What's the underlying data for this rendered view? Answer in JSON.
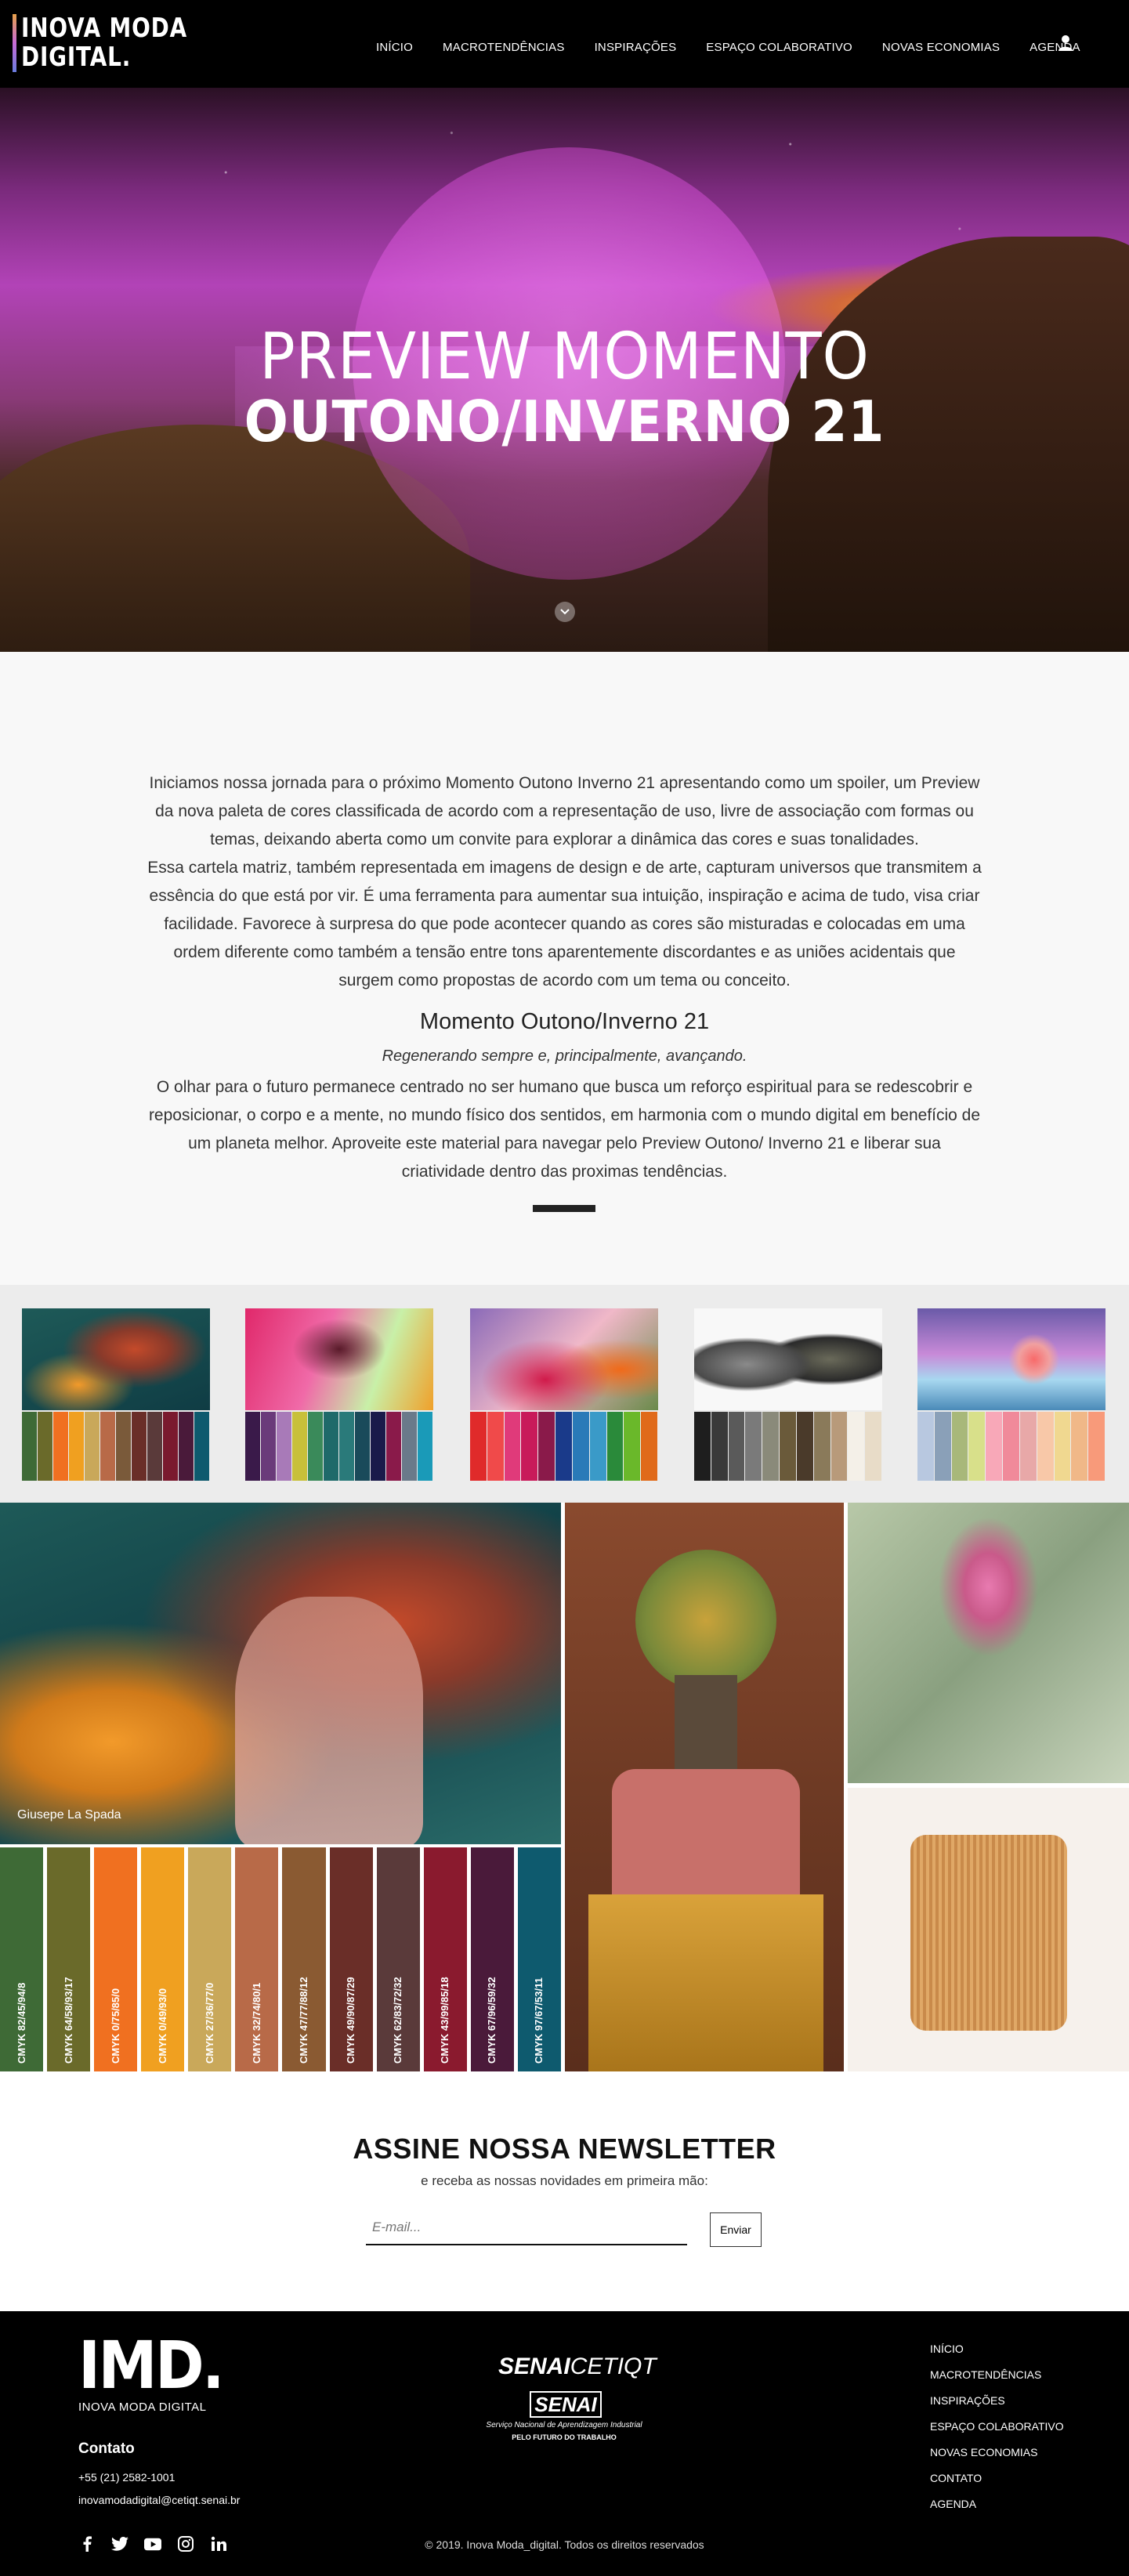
{
  "header": {
    "logo_line1": "INOVA MODA",
    "logo_line2": "DIGITAL.",
    "nav": [
      "INÍCIO",
      "MACROTENDÊNCIAS",
      "INSPIRAÇÕES",
      "ESPAÇO COLABORATIVO",
      "NOVAS ECONOMIAS",
      "AGENDA"
    ],
    "user_icon": "user-icon"
  },
  "hero": {
    "title_line1": "PREVIEW MOMENTO",
    "title_line2": "OUTONO/INVERNO 21",
    "scroll_icon": "chevron-down-icon"
  },
  "intro": {
    "paragraph1": "Iniciamos nossa jornada para o próximo Momento Outono Inverno 21 apresentando como um spoiler, um Preview da nova paleta de cores classificada de acordo com a representação de uso, livre de associação com formas ou temas, deixando aberta como um convite para explorar a dinâmica das cores e suas tonalidades.",
    "paragraph2": "Essa cartela matriz, também representada em imagens de design e de arte, capturam universos que transmitem a essência do que está por vir. É uma ferramenta para aumentar sua intuição, inspiração e acima de tudo, visa criar facilidade. Favorece à surpresa do que pode acontecer quando as cores são misturadas e colocadas em uma ordem diferente como também a tensão entre tons aparentemente discordantes e as uniões acidentais que surgem como propostas de acordo com um tema ou conceito.",
    "subtitle": "Momento Outono/Inverno 21",
    "italic_line": "Regenerando sempre e, principalmente, avançando.",
    "paragraph3": "O olhar para o futuro permanece centrado no ser humano que busca um reforço espiritual para se redescobrir e reposicionar, o corpo e a mente, no mundo físico dos sentidos, em harmonia com o mundo digital em benefício de um planeta melhor. Aproveite este material para navegar pelo Preview Outono/ Inverno 21 e liberar sua criatividade dentro das proximas tendências."
  },
  "palettes": [
    {
      "image": "underwater-woman",
      "colors": [
        "#3e6a36",
        "#6a6a2a",
        "#f07020",
        "#f0a020",
        "#c9a85a",
        "#b86a48",
        "#7a5a3a",
        "#6a2e28",
        "#5a3a3a",
        "#7a1a2e",
        "#4a1a3a",
        "#0e5a6e"
      ]
    },
    {
      "image": "pink-hair-woman",
      "colors": [
        "#3a1a4a",
        "#6a3a7a",
        "#a87ab8",
        "#c8c03a",
        "#3a8a5a",
        "#1e6a6a",
        "#2a7a7a",
        "#1a4a5a",
        "#1a1a4a",
        "#8a1a4a",
        "#6a7a8a",
        "#1a9ab8"
      ]
    },
    {
      "image": "flowers-fabric",
      "colors": [
        "#e02a2a",
        "#f04a4a",
        "#e03a7a",
        "#c81a5a",
        "#8a1a4a",
        "#1a3a8a",
        "#2a7ab8",
        "#3a9ac8",
        "#2a8a3a",
        "#6ab82a",
        "#e06a1a"
      ]
    },
    {
      "image": "stone-bowls",
      "colors": [
        "#1e1e1e",
        "#3a3a3a",
        "#5a5a5a",
        "#7a7a7a",
        "#8a8a7a",
        "#6a5a3a",
        "#4a3a2a",
        "#8a7a5a",
        "#b89a7a",
        "#f4f0e8",
        "#e8dcc8"
      ]
    },
    {
      "image": "surreal-landscape",
      "colors": [
        "#b8c8e0",
        "#8aa0b8",
        "#a8b87a",
        "#d8e08a",
        "#f8a8b8",
        "#f08a9a",
        "#e8a8a8",
        "#f8c8a8",
        "#f0d890",
        "#f0b888",
        "#f89a7a"
      ]
    }
  ],
  "mosaic": {
    "credit": "Giusepe La Spada",
    "cmyk": [
      {
        "label": "CMYK 82/45/94/8",
        "color": "#3e6a36"
      },
      {
        "label": "CMYK 64/58/93/17",
        "color": "#6a6a2a"
      },
      {
        "label": "CMYK 0/75/85/0",
        "color": "#f07020"
      },
      {
        "label": "CMYK 0/49/93/0",
        "color": "#f0a020"
      },
      {
        "label": "CMYK 27/36/77/0",
        "color": "#c9a85a"
      },
      {
        "label": "CMYK 32/74/80/1",
        "color": "#b86a48"
      },
      {
        "label": "CMYK 47/77/88/12",
        "color": "#8a5a32"
      },
      {
        "label": "CMYK 49/90/87/29",
        "color": "#6a2e28"
      },
      {
        "label": "CMYK 62/83/72/32",
        "color": "#5a3a3a"
      },
      {
        "label": "CMYK 43/99/85/18",
        "color": "#8a1a2e"
      },
      {
        "label": "CMYK 67/96/59/32",
        "color": "#4a1a3a"
      },
      {
        "label": "CMYK 97/67/53/11",
        "color": "#0e5a6e"
      }
    ]
  },
  "newsletter": {
    "title": "ASSINE NOSSA NEWSLETTER",
    "subtitle": "e receba as nossas novidades em primeira mão:",
    "placeholder": "E-mail...",
    "button": "Enviar"
  },
  "footer": {
    "logo": "IMD.",
    "logo_sub": "INOVA MODA DIGITAL",
    "contact_title": "Contato",
    "phone": "+55 (21) 2582-1001",
    "email": "inovamodadigital@cetiqt.senai.br",
    "senai_bold": "SENAI",
    "senai_rest": "CETIQT",
    "senai_box": "SENAI",
    "senai_line1": "Serviço Nacional de Aprendizagem Industrial",
    "senai_line2": "PELO FUTURO DO TRABALHO",
    "nav": [
      "INÍCIO",
      "MACROTENDÊNCIAS",
      "INSPIRAÇÕES",
      "ESPAÇO COLABORATIVO",
      "NOVAS ECONOMIAS",
      "CONTATO",
      "AGENDA"
    ],
    "copyright": "© 2019. Inova Moda_digital. Todos os direitos reservados",
    "social": [
      "facebook-icon",
      "twitter-icon",
      "youtube-icon",
      "instagram-icon",
      "linkedin-icon"
    ]
  }
}
